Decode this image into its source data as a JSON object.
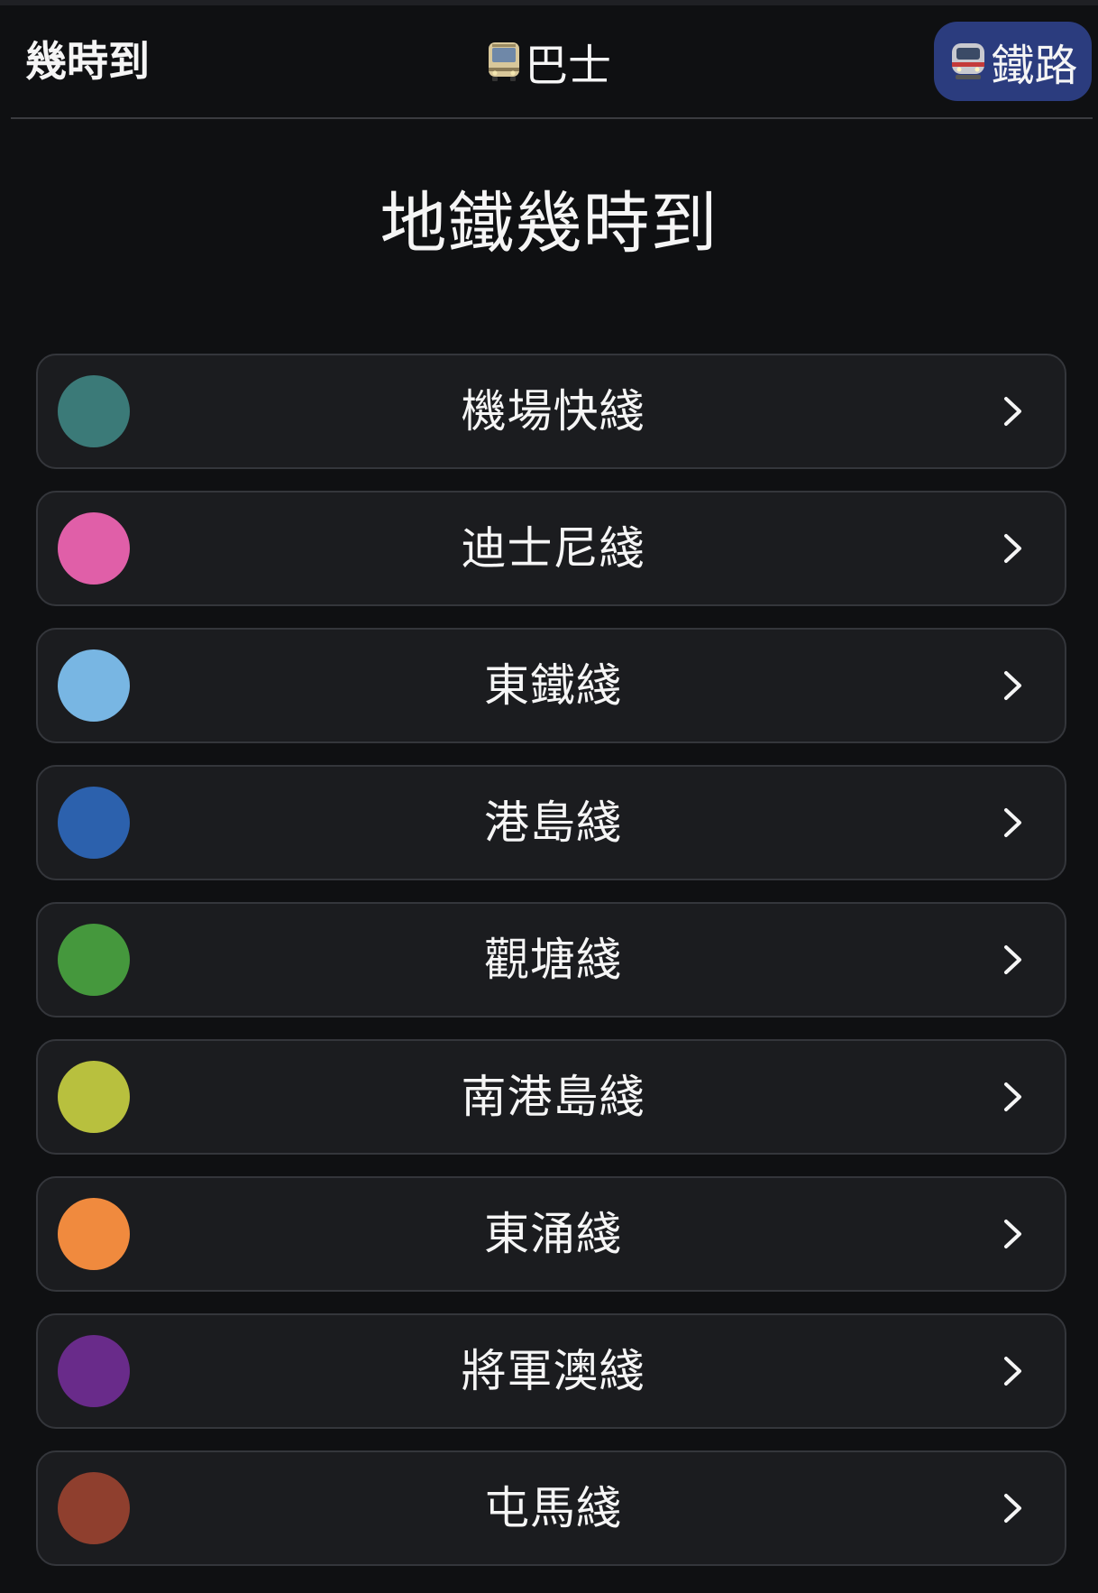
{
  "header": {
    "brand": "幾時到",
    "bus_label": "巴士",
    "rail_label": "鐵路",
    "bus_icon": "bus-icon",
    "rail_icon": "train-icon"
  },
  "page_title": "地鐵幾時到",
  "lines": [
    {
      "name": "機場快綫",
      "color": "#3b7a78"
    },
    {
      "name": "迪士尼綫",
      "color": "#e05fa8"
    },
    {
      "name": "東鐵綫",
      "color": "#78b6e3"
    },
    {
      "name": "港島綫",
      "color": "#2c61ad"
    },
    {
      "name": "觀塘綫",
      "color": "#45983d"
    },
    {
      "name": "南港島綫",
      "color": "#b8c03e"
    },
    {
      "name": "東涌綫",
      "color": "#f08a3e"
    },
    {
      "name": "將軍澳綫",
      "color": "#692b8a"
    },
    {
      "name": "屯馬綫",
      "color": "#8f3f2e"
    }
  ],
  "colors": {
    "background": "#0f1012",
    "card": "#1b1c1f",
    "rail_tab_active": "#2b3c7e"
  }
}
